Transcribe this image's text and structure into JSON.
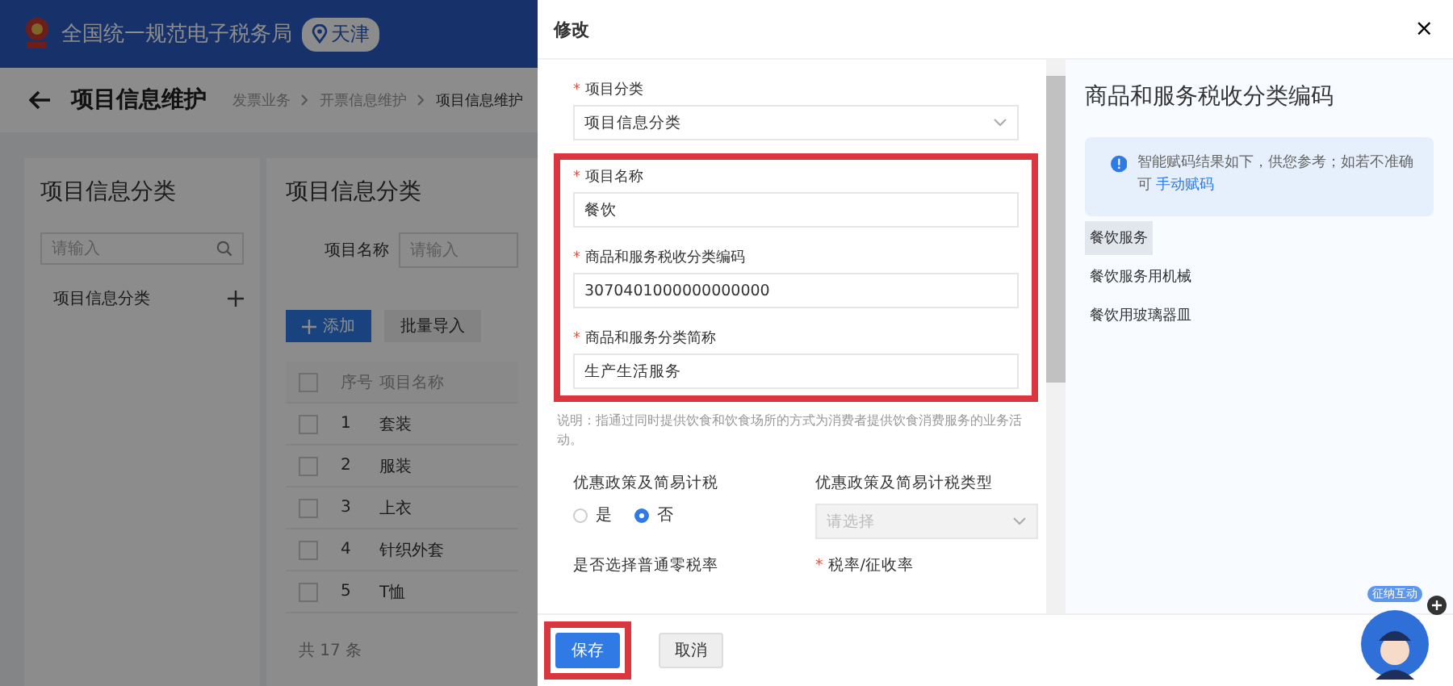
{
  "portal": {
    "title": "全国统一规范电子税务局",
    "region": "天津"
  },
  "page": {
    "title": "项目信息维护",
    "breadcrumb": [
      "发票业务",
      "开票信息维护",
      "项目信息维护"
    ]
  },
  "category_panel": {
    "title": "项目信息分类",
    "search": {
      "placeholder": "请输入"
    },
    "tree": [
      {
        "label": "项目信息分类"
      }
    ]
  },
  "items_panel": {
    "title": "项目信息分类",
    "filter": {
      "label": "项目名称",
      "placeholder": "请输入"
    },
    "buttons": [
      {
        "label": "添加",
        "kind": "primary"
      },
      {
        "label": "批量导入",
        "kind": "default"
      }
    ],
    "table": {
      "columns": [
        "序号",
        "项目名称"
      ],
      "header_checked": false,
      "rows": [
        {
          "cells": [
            "1",
            "套装"
          ],
          "checked": false
        },
        {
          "cells": [
            "2",
            "服装"
          ],
          "checked": false
        },
        {
          "cells": [
            "3",
            "上衣"
          ],
          "checked": false
        },
        {
          "cells": [
            "4",
            "针织外套"
          ],
          "checked": false
        },
        {
          "cells": [
            "5",
            "T恤"
          ],
          "checked": false
        }
      ]
    },
    "total": "共 17 条"
  },
  "drawer": {
    "title": "修改",
    "close": "×",
    "form_groups": [
      {
        "highlighted": false,
        "fields": [
          {
            "kind": "select",
            "mark": "*",
            "label": "项目分类",
            "value": "项目信息分类"
          }
        ]
      },
      {
        "highlighted": true,
        "fields": [
          {
            "kind": "input",
            "mark": "*",
            "label": "项目名称",
            "value": "餐饮"
          },
          {
            "kind": "input",
            "mark": "*",
            "label": "商品和服务税收分类编码",
            "value": "3070401000000000000"
          },
          {
            "kind": "input",
            "mark": "*",
            "label": "商品和服务分类简称",
            "value": "生产生活服务"
          }
        ]
      }
    ],
    "note": "说明：指通过同时提供饮食和饮食场所的方式为消费者提供饮食消费服务的业务活动。",
    "tax_fields": [
      {
        "kind": "radio",
        "label": "优惠政策及简易计税",
        "options": [
          {
            "label": "是",
            "selected": false
          },
          {
            "label": "否",
            "selected": true
          }
        ]
      },
      {
        "kind": "select",
        "label": "优惠政策及简易计税类型",
        "placeholder": "请选择",
        "disabled": true
      }
    ],
    "more_labels": [
      {
        "label": "是否选择普通零税率"
      },
      {
        "label": "税率/征收率",
        "mark": "*"
      }
    ],
    "actions": [
      {
        "label": "保存",
        "kind": "primary",
        "highlighted": true
      },
      {
        "label": "取消",
        "kind": "default",
        "highlighted": false
      }
    ]
  },
  "code_panel": {
    "title": "商品和服务税收分类编码",
    "notice": "智能赋码结果如下，供您参考；如若不准确可",
    "notice_link": "手动赋码",
    "suggestions": [
      {
        "label": "餐饮服务",
        "selected": true
      },
      {
        "label": "餐饮服务用机械",
        "selected": false
      },
      {
        "label": "餐饮用玻璃器皿",
        "selected": false
      }
    ]
  },
  "assistant": {
    "label": "征纳互动"
  }
}
